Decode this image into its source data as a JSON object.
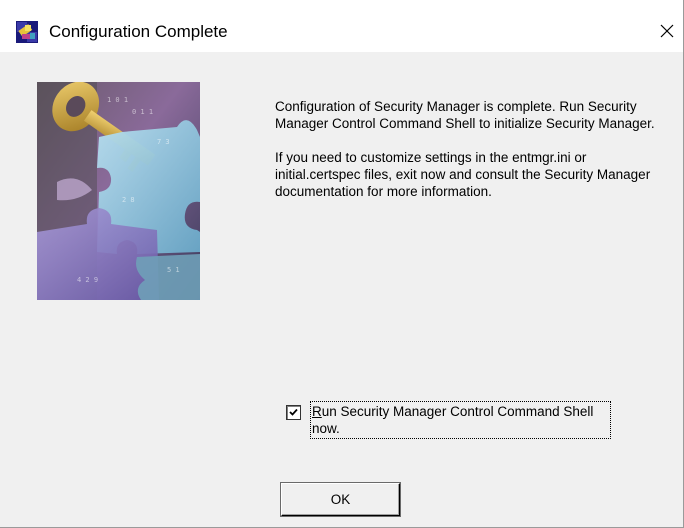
{
  "window": {
    "title": "Configuration Complete",
    "close_glyph": "✕"
  },
  "icons": {
    "app": "installer-app-icon",
    "close": "close-icon",
    "side_image": "keys-and-puzzle-pieces-illustration"
  },
  "message": {
    "paragraph1": "Configuration of Security Manager is complete. Run Security Manager Control Command Shell to initialize Security Manager.",
    "paragraph2": "If you need to customize settings in the entmgr.ini or initial.certspec files, exit now and consult the Security Manager documentation for more information."
  },
  "run_shell_option": {
    "accesskey_char": "R",
    "label_rest": "un Security Manager Control Command Shell now.",
    "checked": true
  },
  "buttons": {
    "ok_label": "OK"
  }
}
